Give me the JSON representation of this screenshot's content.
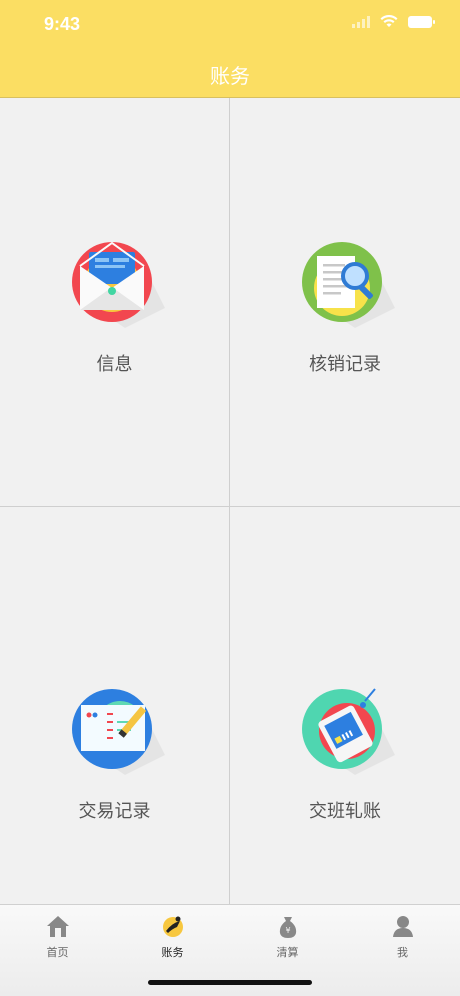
{
  "status_bar": {
    "time": "9:43"
  },
  "header": {
    "title": "账务"
  },
  "grid": {
    "items": [
      {
        "label": "信息",
        "icon": "mail-icon"
      },
      {
        "label": "核销记录",
        "icon": "document-search-icon"
      },
      {
        "label": "交易记录",
        "icon": "notepad-pencil-icon"
      },
      {
        "label": "交班轧账",
        "icon": "card-tag-icon"
      }
    ]
  },
  "tabbar": {
    "items": [
      {
        "label": "首页",
        "icon": "home-icon"
      },
      {
        "label": "账务",
        "icon": "accounts-icon",
        "active": true
      },
      {
        "label": "清算",
        "icon": "money-bag-icon"
      },
      {
        "label": "我",
        "icon": "person-icon"
      }
    ]
  },
  "colors": {
    "accent": "#fbde63",
    "background": "#f1f1f1"
  }
}
